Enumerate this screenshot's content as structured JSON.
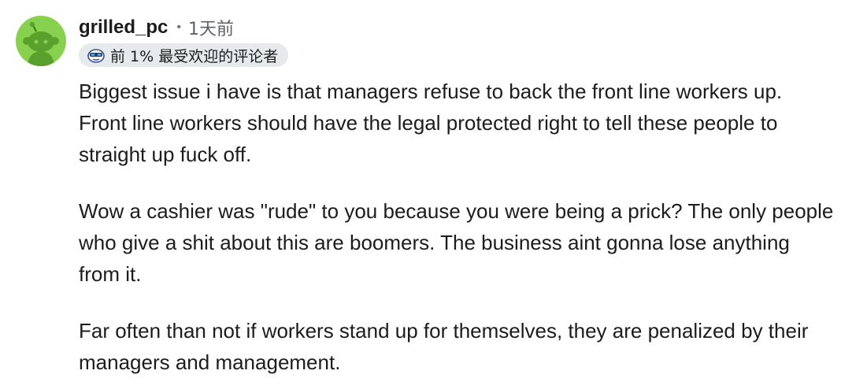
{
  "comment": {
    "author": "grilled_pc",
    "separator": "•",
    "time": "1天前",
    "avatar_icon": "snoo-avatar-icon",
    "avatar_color": "#87d14e",
    "flair": {
      "icon": "sunglasses-snoo-icon",
      "text": "前 1% 最受欢迎的评论者",
      "background": "#e6eaec"
    },
    "paragraphs": [
      "Biggest issue i have is that managers refuse to back the front line workers up. Front line workers should have the legal protected right to tell these people to straight up fuck off.",
      "Wow a cashier was \"rude\" to you because you were being a prick? The only people who give a shit about this are boomers. The business aint gonna lose anything from it.",
      "Far often than not if workers stand up for themselves, they are penalized by their managers and management."
    ]
  }
}
